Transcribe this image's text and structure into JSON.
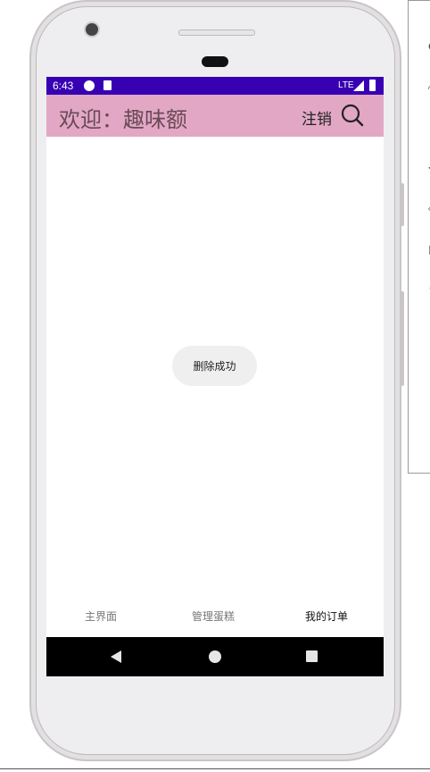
{
  "status_bar": {
    "time": "6:43",
    "network": "LTE"
  },
  "app_bar": {
    "title": "欢迎：趣味额",
    "logout_label": "注销",
    "search_icon": "search-icon",
    "background_color": "#e2a7c5"
  },
  "toast": {
    "message": "删除成功"
  },
  "bottom_nav": {
    "items": [
      {
        "label": "主界面",
        "active": false
      },
      {
        "label": "管理蛋糕",
        "active": false
      },
      {
        "label": "我的订单",
        "active": true
      }
    ]
  },
  "system_nav": {
    "back_icon": "back-triangle-icon",
    "home_icon": "home-circle-icon",
    "recent_icon": "recents-square-icon"
  },
  "colors": {
    "status_bar": "#3700b3",
    "nav_bar": "#000000"
  }
}
